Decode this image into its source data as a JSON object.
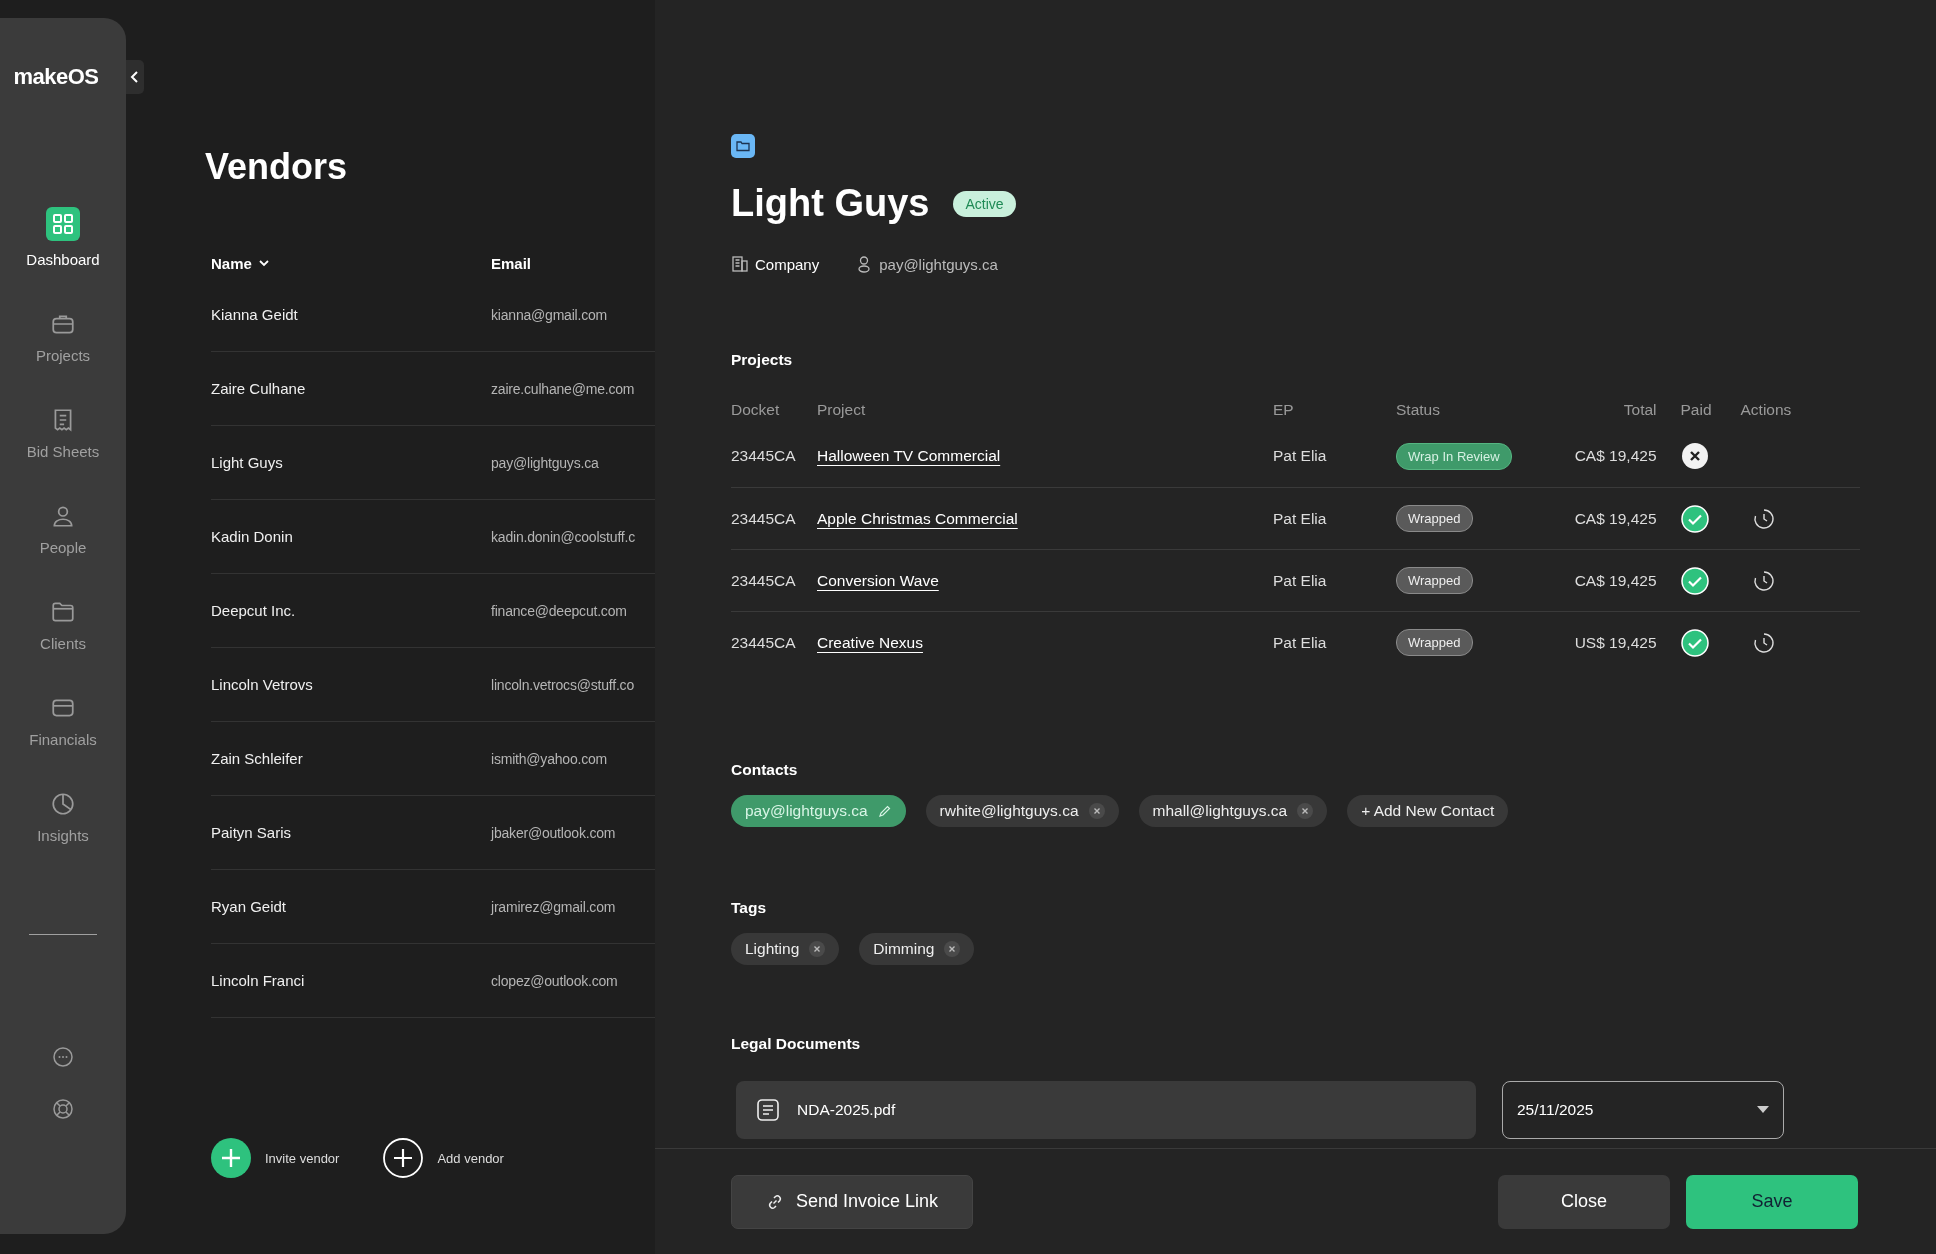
{
  "brand": "makeOS",
  "nav": [
    {
      "label": "Dashboard",
      "selected": true
    },
    {
      "label": "Projects",
      "selected": false
    },
    {
      "label": "Bid Sheets",
      "selected": false
    },
    {
      "label": "People",
      "selected": false
    },
    {
      "label": "Clients",
      "selected": false
    },
    {
      "label": "Financials",
      "selected": false
    },
    {
      "label": "Insights",
      "selected": false
    }
  ],
  "vendors": {
    "title": "Vendors",
    "columns": [
      {
        "label": "Name",
        "sorted": true
      },
      {
        "label": "Email",
        "sorted": false
      }
    ],
    "rows": [
      {
        "name": "Kianna Geidt",
        "email": "kianna@gmail.com"
      },
      {
        "name": "Zaire Culhane",
        "email": "zaire.culhane@me.com"
      },
      {
        "name": "Light Guys",
        "email": "pay@lightguys.ca"
      },
      {
        "name": "Kadin Donin",
        "email": "kadin.donin@coolstuff.c"
      },
      {
        "name": "Deepcut Inc.",
        "email": "finance@deepcut.com"
      },
      {
        "name": "Lincoln Vetrovs",
        "email": "lincoln.vetrocs@stuff.co"
      },
      {
        "name": "Zain Schleifer",
        "email": "ismith@yahoo.com"
      },
      {
        "name": "Paityn Saris",
        "email": "jbaker@outlook.com"
      },
      {
        "name": "Ryan Geidt",
        "email": "jramirez@gmail.com"
      },
      {
        "name": "Lincoln Franci",
        "email": "clopez@outlook.com"
      }
    ],
    "actions": [
      {
        "label": "Invite vendor",
        "kind": "filled"
      },
      {
        "label": "Add vendor",
        "kind": "outline"
      }
    ]
  },
  "detail": {
    "name": "Light Guys",
    "status": "Active",
    "type": "Company",
    "email": "pay@lightguys.ca",
    "projects": {
      "title": "Projects",
      "columns": [
        "Docket",
        "Project",
        "EP",
        "Status",
        "Total",
        "Paid",
        "Actions"
      ],
      "rows": [
        {
          "docket": "23445CA",
          "project": "Halloween TV Commercial",
          "ep": "Pat Elia",
          "status": "Wrap In Review",
          "kind": "review",
          "total": "CA$ 19,425",
          "paid": false,
          "history": false
        },
        {
          "docket": "23445CA",
          "project": "Apple Christmas Commercial",
          "ep": "Pat Elia",
          "status": "Wrapped",
          "kind": "wrapped",
          "total": "CA$ 19,425",
          "paid": true,
          "history": true
        },
        {
          "docket": "23445CA",
          "project": "Conversion Wave",
          "ep": "Pat Elia",
          "status": "Wrapped",
          "kind": "wrapped",
          "total": "CA$ 19,425",
          "paid": true,
          "history": true
        },
        {
          "docket": "23445CA",
          "project": "Creative Nexus",
          "ep": "Pat Elia",
          "status": "Wrapped",
          "kind": "wrapped",
          "total": "US$ 19,425",
          "paid": true,
          "history": true
        }
      ]
    },
    "contacts": {
      "title": "Contacts",
      "items": [
        {
          "email": "pay@lightguys.ca",
          "primary": true
        },
        {
          "email": "rwhite@lightguys.ca",
          "primary": false
        },
        {
          "email": "mhall@lightguys.ca",
          "primary": false
        }
      ],
      "add": "+ Add New Contact"
    },
    "tags": {
      "title": "Tags",
      "items": [
        "Lighting",
        "Dimming"
      ]
    },
    "legal": {
      "title": "Legal Documents",
      "file": "NDA-2025.pdf",
      "date": "25/11/2025"
    },
    "buttons": {
      "send": "Send Invoice Link",
      "close": "Close",
      "save": "Save"
    }
  }
}
